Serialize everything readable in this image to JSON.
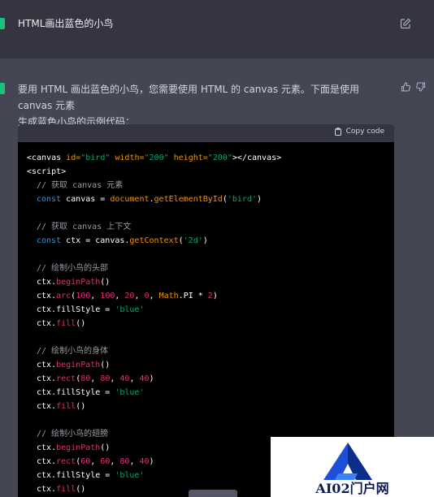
{
  "user_message": "HTML画出蓝色的小鸟",
  "assistant": {
    "intro_line1": "要用 HTML 画出蓝色的小鸟，您需要使用 HTML 的 canvas 元素。下面是使用 canvas 元素",
    "intro_line2": "生成蓝色小鸟的示例代码："
  },
  "code_block": {
    "copy_label": "Copy code",
    "lines": {
      "l1_tag_open": "<canvas ",
      "l1_attr1": "id=",
      "l1_val1": "\"bird\"",
      "l1_attr2": " width=",
      "l1_val2": "\"200\"",
      "l1_attr3": " height=",
      "l1_val3": "\"200\"",
      "l1_tag_close": "></canvas>",
      "l2": "<script>",
      "c1": "// 获取 canvas 元素",
      "l3_kw": "const",
      "l3_a": " canvas = ",
      "l3_obj": "document",
      "l3_dot": ".",
      "l3_fn": "getElementById",
      "l3_p1": "(",
      "l3_str": "'bird'",
      "l3_p2": ")",
      "c2": "// 获取 canvas 上下文",
      "l4_kw": "const",
      "l4_a": " ctx = canvas.",
      "l4_fn": "getContext",
      "l4_p1": "(",
      "l4_str": "'2d'",
      "l4_p2": ")",
      "c3": "// 绘制小鸟的头部",
      "l5_a": "ctx.",
      "l5_fn": "beginPath",
      "l5_p": "()",
      "l6_a": "ctx.",
      "l6_fn": "arc",
      "l6_p1": "(",
      "l6_n1": "100",
      "l6_s1": ", ",
      "l6_n2": "100",
      "l6_s2": ", ",
      "l6_n3": "20",
      "l6_s3": ", ",
      "l6_n4": "0",
      "l6_s4": ", ",
      "l6_math": "Math",
      "l6_pi": ".PI * ",
      "l6_n5": "2",
      "l6_p2": ")",
      "l7_a": "ctx.fillStyle = ",
      "l7_str": "'blue'",
      "l8_a": "ctx.",
      "l8_fn": "fill",
      "l8_p": "()",
      "c4": "// 绘制小鸟的身体",
      "l9_a": "ctx.",
      "l9_fn": "beginPath",
      "l9_p": "()",
      "l10_a": "ctx.",
      "l10_fn": "rect",
      "l10_p1": "(",
      "l10_n1": "80",
      "l10_s1": ", ",
      "l10_n2": "80",
      "l10_s2": ", ",
      "l10_n3": "40",
      "l10_s3": ", ",
      "l10_n4": "40",
      "l10_p2": ")",
      "l11_a": "ctx.fillStyle = ",
      "l11_str": "'blue'",
      "l12_a": "ctx.",
      "l12_fn": "fill",
      "l12_p": "()",
      "c5": "// 绘制小鸟的翅膀",
      "l13_a": "ctx.",
      "l13_fn": "beginPath",
      "l13_p": "()",
      "l14_a": "ctx.",
      "l14_fn": "rect",
      "l14_p1": "(",
      "l14_n1": "60",
      "l14_s1": ", ",
      "l14_n2": "60",
      "l14_s2": ", ",
      "l14_n3": "80",
      "l14_s3": ", ",
      "l14_n4": "40",
      "l14_p2": ")",
      "l15_a": "ctx.fillStyle = ",
      "l15_str": "'blue'",
      "l16_a": "ctx.",
      "l16_fn": "fill",
      "l16_p": "()"
    }
  },
  "watermark": {
    "text": "AI02门户网"
  },
  "colors": {
    "accent_green": "#19c37d",
    "keyword": "#2e95d3",
    "function": "#df3079",
    "string": "#00a67d",
    "comment": "#9a9aa5",
    "attribute": "#e9950c"
  },
  "icons": [
    "edit-icon",
    "thumb-up-icon",
    "thumb-down-icon",
    "clipboard-icon"
  ]
}
